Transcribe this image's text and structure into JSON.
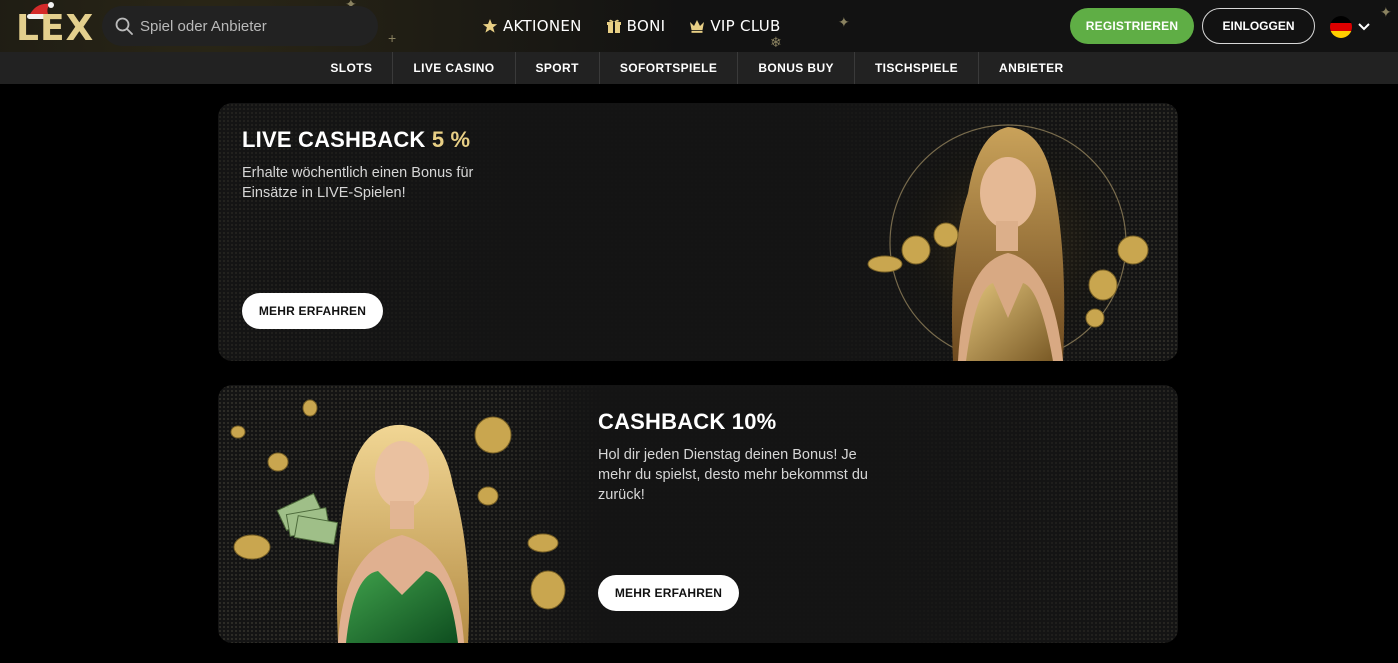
{
  "header": {
    "logo_text": "LEX",
    "search_placeholder": "Spiel oder Anbieter",
    "nav": [
      {
        "label": "AKTIONEN",
        "icon": "star-icon"
      },
      {
        "label": "BONI",
        "icon": "gift-icon"
      },
      {
        "label": "VIP CLUB",
        "icon": "crown-icon"
      }
    ],
    "register_label": "REGISTRIEREN",
    "login_label": "EINLOGGEN",
    "language_flag": "de-flag-icon"
  },
  "categories": [
    "SLOTS",
    "LIVE CASINO",
    "SPORT",
    "SOFORTSPIELE",
    "BONUS BUY",
    "TISCHSPIELE",
    "ANBIETER"
  ],
  "promos": [
    {
      "title_main": "LIVE CASHBACK ",
      "title_accent": "5 %",
      "description": "Erhalte wöchentlich einen Bonus für Einsätze in LIVE-Spielen!",
      "button": "MEHR ERFAHREN"
    },
    {
      "title_main": "CASHBACK 10%",
      "title_accent": "",
      "description": "Hol dir jeden Dienstag deinen Bonus! Je mehr du spielst, desto mehr bekommst du zurück!",
      "button": "MEHR ERFAHREN"
    }
  ],
  "colors": {
    "accent_gold": "#e8cf85",
    "register_green": "#5fae45",
    "background": "#000000",
    "card_bg": "#141414"
  }
}
